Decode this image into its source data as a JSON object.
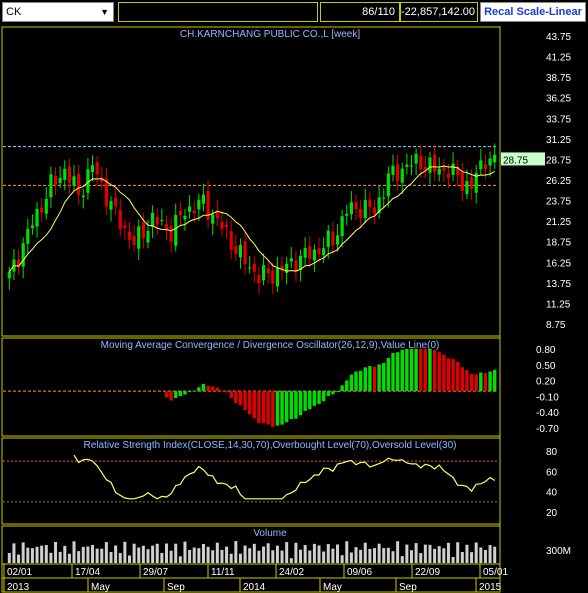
{
  "toolbar": {
    "ticker": "CK",
    "counter": "86/110",
    "value": "-22,857,142.00",
    "recal_label": "Recal Scale-Linear"
  },
  "colors": {
    "up": "#00e000",
    "down": "#e00000",
    "sma": "#ffff60",
    "title": "#8fb8ff",
    "frame": "#c8c800",
    "resistance": "#8ad8ff",
    "support": "#ff9933"
  },
  "price_panel": {
    "title": "CH.KARNCHANG PUBLIC CO.,L [week]",
    "ticks": [
      "43.75",
      "41.25",
      "38.75",
      "36.25",
      "33.75",
      "31.25",
      "28.75",
      "26.25",
      "23.75",
      "21.25",
      "18.75",
      "16.25",
      "13.75",
      "11.25",
      "8.75"
    ],
    "last_label": "28.75",
    "resistance": 30.3,
    "support": 25.6
  },
  "macd_panel": {
    "title": "Moving Average Convergence / Divergence Oscillator(26,12,9),Value Line(0)",
    "ticks": [
      "0.80",
      "0.50",
      "0.20",
      "-0.10",
      "-0.40",
      "-0.70"
    ]
  },
  "rsi_panel": {
    "title": "Relative Strength Index(CLOSE,14,30,70),Overbought Level(70),Oversold Level(30)",
    "ticks": [
      "80",
      "60",
      "40",
      "20"
    ]
  },
  "volume_panel": {
    "title": "Volume",
    "tick": "300M"
  },
  "x_axis": {
    "dates": [
      "02/01",
      "17/04",
      "29/07",
      "11/11",
      "24/02",
      "09/06",
      "22/09",
      "05/01"
    ],
    "months": [
      "2013",
      "May",
      "Sep",
      "2014",
      "May",
      "Sep",
      "2015"
    ]
  },
  "chart_data": {
    "type": "candlestick",
    "title": "CH.KARNCHANG PUBLIC CO.,L [week]",
    "weeks": 106,
    "close_anchors": [
      [
        0,
        14.5
      ],
      [
        5,
        21
      ],
      [
        9,
        25.5
      ],
      [
        12,
        27.5
      ],
      [
        15,
        24.5
      ],
      [
        18,
        28
      ],
      [
        23,
        22
      ],
      [
        27,
        18.5
      ],
      [
        31,
        21.5
      ],
      [
        35,
        20
      ],
      [
        38,
        22.5
      ],
      [
        42,
        23.5
      ],
      [
        46,
        20.5
      ],
      [
        50,
        17
      ],
      [
        54,
        14.5
      ],
      [
        58,
        15
      ],
      [
        62,
        16.5
      ],
      [
        66,
        17.5
      ],
      [
        70,
        19
      ],
      [
        73,
        22.5
      ],
      [
        76,
        23
      ],
      [
        79,
        22.5
      ],
      [
        82,
        26.5
      ],
      [
        86,
        28
      ],
      [
        89,
        28.5
      ],
      [
        92,
        27.5
      ],
      [
        95,
        27.5
      ],
      [
        98,
        26
      ],
      [
        100,
        25.5
      ],
      [
        103,
        29
      ],
      [
        105,
        28.5
      ]
    ],
    "ylim": [
      8.75,
      43.75
    ],
    "sma_period": 10,
    "macd_range": [
      -0.7,
      0.8
    ],
    "rsi_range": [
      20,
      80
    ],
    "rsi_overbought": 70,
    "rsi_oversold": 30
  }
}
